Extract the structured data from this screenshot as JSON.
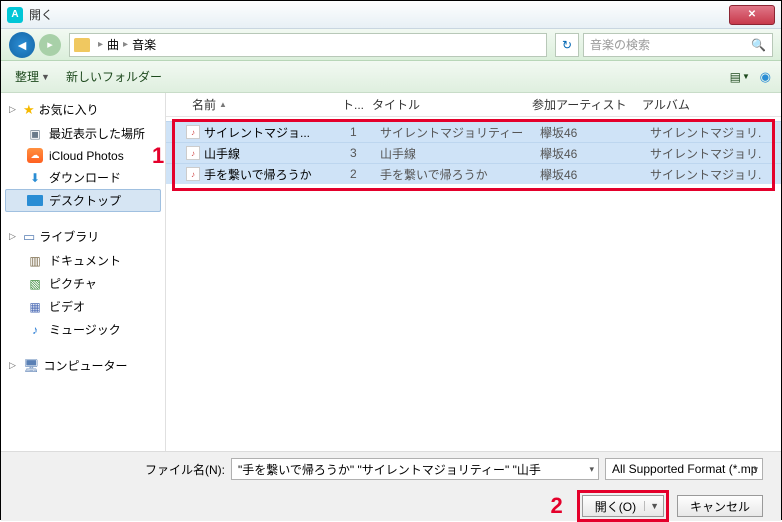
{
  "window": {
    "title": "開く"
  },
  "nav": {
    "crumb1": "曲",
    "crumb2": "音楽",
    "search_placeholder": "音楽の検索"
  },
  "toolbar": {
    "organize": "整理",
    "new_folder": "新しいフォルダー"
  },
  "sidebar": {
    "favorites_label": "お気に入り",
    "recent": "最近表示した場所",
    "icloud": "iCloud Photos",
    "downloads": "ダウンロード",
    "desktop": "デスクトップ",
    "library_label": "ライブラリ",
    "documents": "ドキュメント",
    "pictures": "ピクチャ",
    "videos": "ビデオ",
    "music": "ミュージック",
    "computer_label": "コンピューター"
  },
  "columns": {
    "name": "名前",
    "track": "ト...",
    "title": "タイトル",
    "artist": "参加アーティスト",
    "album": "アルバム"
  },
  "files": [
    {
      "name": "サイレントマジョ...",
      "track": "1",
      "title": "サイレントマジョリティー",
      "artist": "欅坂46",
      "album": "サイレントマジョリ."
    },
    {
      "name": "山手線",
      "track": "3",
      "title": "山手線",
      "artist": "欅坂46",
      "album": "サイレントマジョリ."
    },
    {
      "name": "手を繋いで帰ろうか",
      "track": "2",
      "title": "手を繋いで帰ろうか",
      "artist": "欅坂46",
      "album": "サイレントマジョリ."
    }
  ],
  "footer": {
    "filename_label": "ファイル名(N):",
    "filename_value": "\"手を繋いで帰ろうか\" \"サイレントマジョリティー\" \"山手",
    "filter_label": "All Supported Format (*.mp",
    "open_btn": "開く(O)",
    "cancel_btn": "キャンセル"
  },
  "annotations": {
    "one": "1",
    "two": "2"
  }
}
